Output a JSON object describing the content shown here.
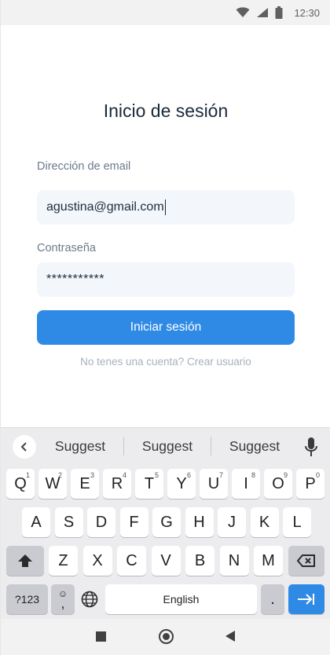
{
  "status_bar": {
    "time": "12:30",
    "icons": [
      "wifi-icon",
      "signal-icon",
      "battery-icon"
    ]
  },
  "login": {
    "title": "Inicio de sesión",
    "email_label": "Dirección de email",
    "email_value": "agustina@gmail.com",
    "password_label": "Contraseña",
    "password_value": "***********",
    "submit_label": "Iniciar sesión",
    "signup_text": "No tenes una cuenta? Crear usuario"
  },
  "colors": {
    "accent": "#2f8ae6",
    "input_bg": "#f3f6fb",
    "title": "#1a2a3a",
    "muted": "#a7b1bd"
  },
  "keyboard": {
    "suggestions": [
      "Suggest",
      "Suggest",
      "Suggest"
    ],
    "row1": [
      {
        "key": "Q",
        "num": "1"
      },
      {
        "key": "W",
        "num": "2"
      },
      {
        "key": "E",
        "num": "3"
      },
      {
        "key": "R",
        "num": "4"
      },
      {
        "key": "T",
        "num": "5"
      },
      {
        "key": "Y",
        "num": "6"
      },
      {
        "key": "U",
        "num": "7"
      },
      {
        "key": "I",
        "num": "8"
      },
      {
        "key": "O",
        "num": "9"
      },
      {
        "key": "P",
        "num": "0"
      }
    ],
    "row2": [
      "A",
      "S",
      "D",
      "F",
      "G",
      "H",
      "J",
      "K",
      "L"
    ],
    "row3": [
      "Z",
      "X",
      "C",
      "V",
      "B",
      "N",
      "M"
    ],
    "symbols_label": "?123",
    "emoji_comma_top": "☺",
    "emoji_comma_bottom": ",",
    "space_label": "English",
    "period_label": ".",
    "icons": [
      "shift-icon",
      "backspace-icon",
      "globe-icon",
      "enter-tab-icon",
      "mic-icon",
      "back-chevron-icon"
    ]
  },
  "nav_bar": {
    "icons": [
      "recents-square-icon",
      "home-circle-icon",
      "back-triangle-icon"
    ]
  }
}
